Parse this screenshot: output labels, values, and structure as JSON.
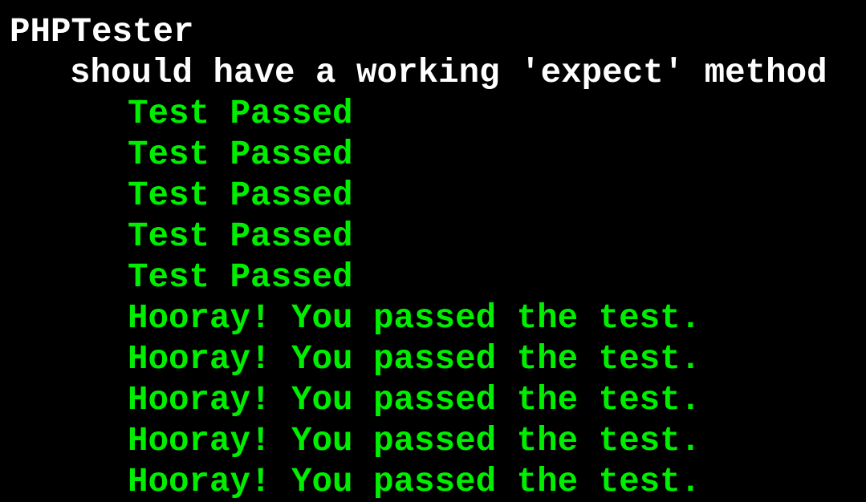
{
  "output": {
    "suite_title": "PHPTester",
    "spec_title": "should have a working 'expect' method",
    "results": [
      "Test Passed",
      "Test Passed",
      "Test Passed",
      "Test Passed",
      "Test Passed",
      "Hooray! You passed the test.",
      "Hooray! You passed the test.",
      "Hooray! You passed the test.",
      "Hooray! You passed the test.",
      "Hooray! You passed the test."
    ]
  },
  "colors": {
    "background": "#000000",
    "heading_text": "#ffffff",
    "pass_text": "#00ee00"
  }
}
